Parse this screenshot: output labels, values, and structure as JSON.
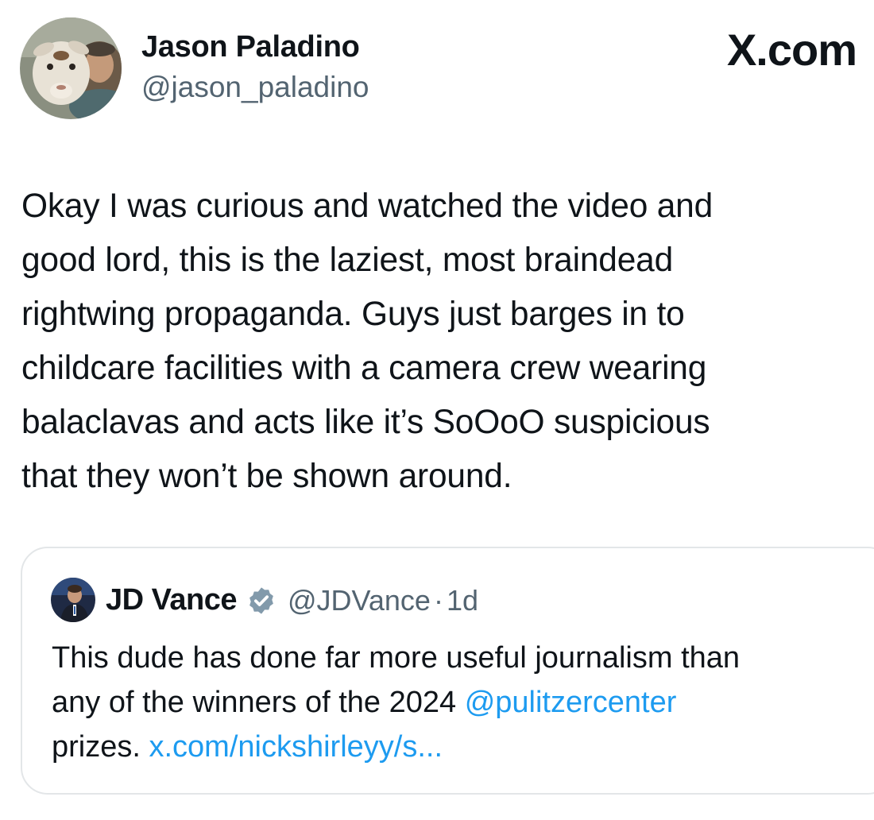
{
  "author": {
    "display_name": "Jason Paladino",
    "handle": "@jason_paladino",
    "avatar_icon": "avatar-goat-photo"
  },
  "brand": {
    "label": "X.com"
  },
  "tweet": {
    "lines": [
      "Okay I was curious and watched the video and",
      "good lord, this is the laziest, most braindead",
      "rightwing propaganda. Guys just barges in to",
      "childcare facilities with a camera crew wearing",
      "balaclavas and acts like it’s SoOoO suspicious",
      "that they won’t be shown around."
    ]
  },
  "quote": {
    "display_name": "JD Vance",
    "verified_icon": "verified-badge-icon",
    "handle": "@JDVance",
    "separator": "·",
    "time": "1d",
    "text_line1": "This dude has done far more useful journalism than",
    "text_line2_before": "any of the winners of the 2024 ",
    "mention": "@pulitzercenter",
    "text_line3_before": "prizes. ",
    "link": "x.com/nickshirleyy/s..."
  },
  "colors": {
    "text": "#0f1419",
    "secondary": "#536471",
    "link": "#1d9bf0",
    "border": "#e3e6e8"
  }
}
